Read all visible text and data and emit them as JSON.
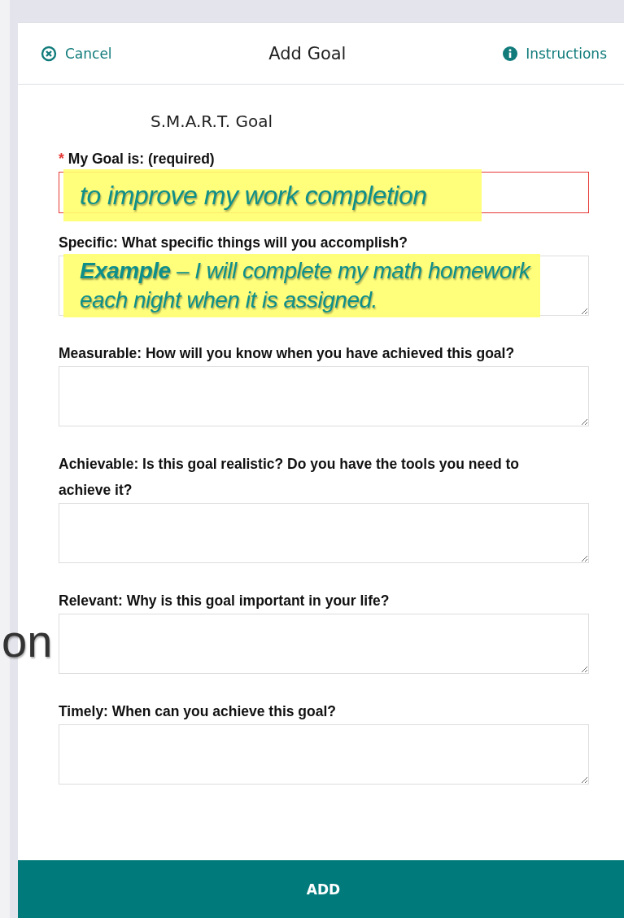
{
  "header": {
    "cancel": "Cancel",
    "title": "Add Goal",
    "instructions": "Instructions"
  },
  "form": {
    "heading": "S.M.A.R.T. Goal",
    "fields": [
      {
        "kind": "input",
        "marker": "*",
        "label": "My Goal is: (required)",
        "invalid": true
      },
      {
        "kind": "textarea",
        "label": "Specific: What specific things will you accomplish?",
        "invalid": false
      },
      {
        "kind": "textarea",
        "label": "Measurable: How will you know when you have achieved this goal?",
        "invalid": false
      },
      {
        "kind": "textarea",
        "label": "Achievable: Is this goal realistic? Do you have the tools you need to achieve it?",
        "invalid": false
      },
      {
        "kind": "textarea",
        "label": "Relevant: Why is this goal important in your life?",
        "invalid": false
      },
      {
        "kind": "textarea",
        "label": "Timely: When can you achieve this goal?",
        "invalid": false
      }
    ]
  },
  "annotations": [
    {
      "text": "to improve my work completion"
    },
    {
      "text": "**Example** – I will complete my math homework each night when it is assigned."
    }
  ],
  "background_text": "on",
  "footer": {
    "button": "ADD"
  }
}
